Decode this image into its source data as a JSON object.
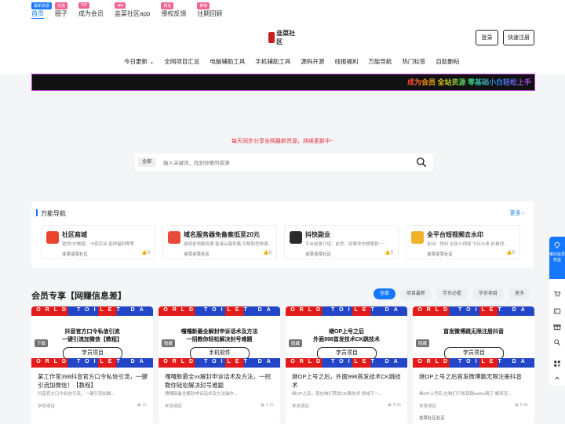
{
  "top_links": [
    {
      "label": "首页",
      "badge": "最新资源",
      "badge_color": "#1677ff",
      "active": true
    },
    {
      "label": "圈子",
      "badge": "交流",
      "badge_color": "#f06292"
    },
    {
      "label": "成为会员",
      "badge": "VIP",
      "badge_color": "#f06292"
    },
    {
      "label": "韭菜社区app",
      "badge": "app",
      "badge_color": "#f06292"
    },
    {
      "label": "侵权反馈",
      "badge": "新站",
      "badge_color": "#f06292"
    },
    {
      "label": "往期回顾",
      "badge": "推荐",
      "badge_color": "#f06292"
    }
  ],
  "logo": {
    "text": "韭菜社区",
    "icon": "chive-logo"
  },
  "auth": {
    "login": "登录",
    "register": "快速注册"
  },
  "main_nav": [
    "今日更新",
    "全网项目汇总",
    "电脑辅助工具",
    "手机辅助工具",
    "源码开源",
    "线报福利",
    "万能导航",
    "热门标签",
    "自助删帖"
  ],
  "main_nav_dropdown_index": 0,
  "marquee": {
    "text": "成为会员 全站资源 零基础小白轻松上手 "
  },
  "hero": {
    "subtitle": "每天同步分享全网最新资源，持续更新中~"
  },
  "search": {
    "scope": "全部",
    "placeholder": "输入关键词，找到你要的资源",
    "icon": "search-icon"
  },
  "nav_panel": {
    "title": "万能导航",
    "more": "更多",
    "cards": [
      {
        "title": "社区商城",
        "desc": "提供OP数据、卡密后台 各种福利等等",
        "footer": "韭菜韭菜社区",
        "likes": "0",
        "icon_color": "#e8432b"
      },
      {
        "title": "域名服务器免备案低至20元",
        "desc": "选择各地服务器 香港云服务器,可帮助您快速...",
        "footer": "韭菜韭菜社区",
        "likes": "0",
        "icon_color": "#e9483b"
      },
      {
        "title": "抖快副业",
        "desc": "平台前景介绍：前言。如果你也想像我一...",
        "footer": "韭菜韭菜社区",
        "likes": "0",
        "icon_color": "#2b2b2b"
      },
      {
        "title": "全平台短视频去水印",
        "desc": "支持：快抖 全民小视频 今日头条 好看视...",
        "footer": "韭菜韭菜社区",
        "likes": "0",
        "icon_color": "#f2b12b"
      }
    ]
  },
  "section": {
    "title": "会员专享【网赚信息差】",
    "tabs": [
      "全部",
      "项目最新",
      "学员必看",
      "学员项目",
      "更多"
    ],
    "active_tab": 0
  },
  "posts": [
    {
      "headline_1": "抖音官方口令私信引流",
      "headline_2": "一键引流加微信【教程】",
      "pill": "学员项目",
      "badge": "下载",
      "title": "某工作室398抖音官方口令私信引流，一键引流加微信！【教程】",
      "desc": "抖音官方口令私信引流，一键引流加微...",
      "category": "学员项目",
      "views": "1k",
      "author": ""
    },
    {
      "headline_1": "嘎嘎新最全解封申诉话术及方法",
      "headline_2": "一招教你轻松解决封号难题",
      "pill": "手机软件",
      "badge": "隐藏",
      "title": "嘎嘎新最全vx解封申诉话术及方法，一招教你轻松解决封号难题",
      "desc": "嘎嘎新最全解封申诉话术及方法操作...",
      "category": "学员项目",
      "views": "1.1k",
      "author": ""
    },
    {
      "headline_1": "继OP上号之后",
      "headline_2": "外面998首发技术CK跳技术",
      "pill": "学员项目",
      "badge": "隐藏",
      "title": "继OP上号之后，外面998首发技术CK跳技术",
      "desc": "继OP之后。现在咱们首发CK跳技术 领域干一...",
      "category": "学员项目",
      "views": "4.5k",
      "author": ""
    },
    {
      "headline_1": "首发微博跳无限注册抖音",
      "headline_2": "",
      "pill": "学员项目",
      "badge": "隐藏",
      "title": "继OP上号之后首发微博跳无限注册抖音",
      "desc": "继OP上号后 在咱们只发现跳weibo跳了 概率还...",
      "category": "学员项目",
      "views": "5.8k",
      "author": "韭菜社区社区"
    }
  ],
  "stripe_text": "ORLD TOILET DA",
  "float_bar": {
    "vip_label": "谁切会员权益",
    "icons": [
      "cart-icon",
      "coupon-icon",
      "gift-icon",
      "search-icon",
      "qr-icon",
      "top-icon"
    ]
  },
  "colors": {
    "accent": "#1677ff",
    "hero_red": "#e0303a"
  }
}
